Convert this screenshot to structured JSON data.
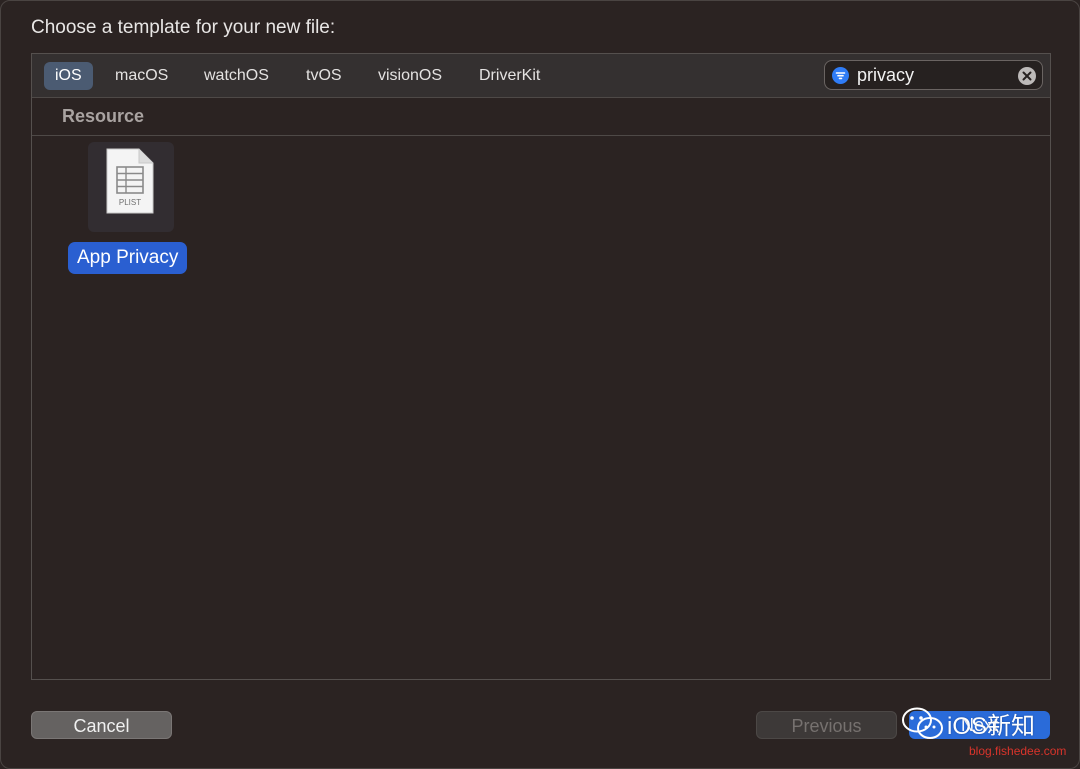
{
  "dialog": {
    "prompt": "Choose a template for your new file:"
  },
  "platform_tabs": [
    {
      "label": "iOS",
      "active": true
    },
    {
      "label": "macOS",
      "active": false
    },
    {
      "label": "watchOS",
      "active": false
    },
    {
      "label": "tvOS",
      "active": false
    },
    {
      "label": "visionOS",
      "active": false
    },
    {
      "label": "DriverKit",
      "active": false
    }
  ],
  "search": {
    "value": "privacy",
    "filter_icon": "filter-icon",
    "clear_icon": "clear-circle-icon"
  },
  "section": {
    "title": "Resource"
  },
  "templates": [
    {
      "label": "App Privacy",
      "file_badge": "PLIST",
      "icon": "plist-file-icon",
      "selected": true
    }
  ],
  "buttons": {
    "cancel": "Cancel",
    "previous": "Previous",
    "next": "Next"
  },
  "watermark": {
    "brand": "iOS新知",
    "url": "blog.fishedee.com"
  },
  "colors": {
    "background": "#2b2322",
    "accent": "#2a5fd1",
    "active_tab": "#4b5b72",
    "watermark_url": "#d9342b"
  }
}
